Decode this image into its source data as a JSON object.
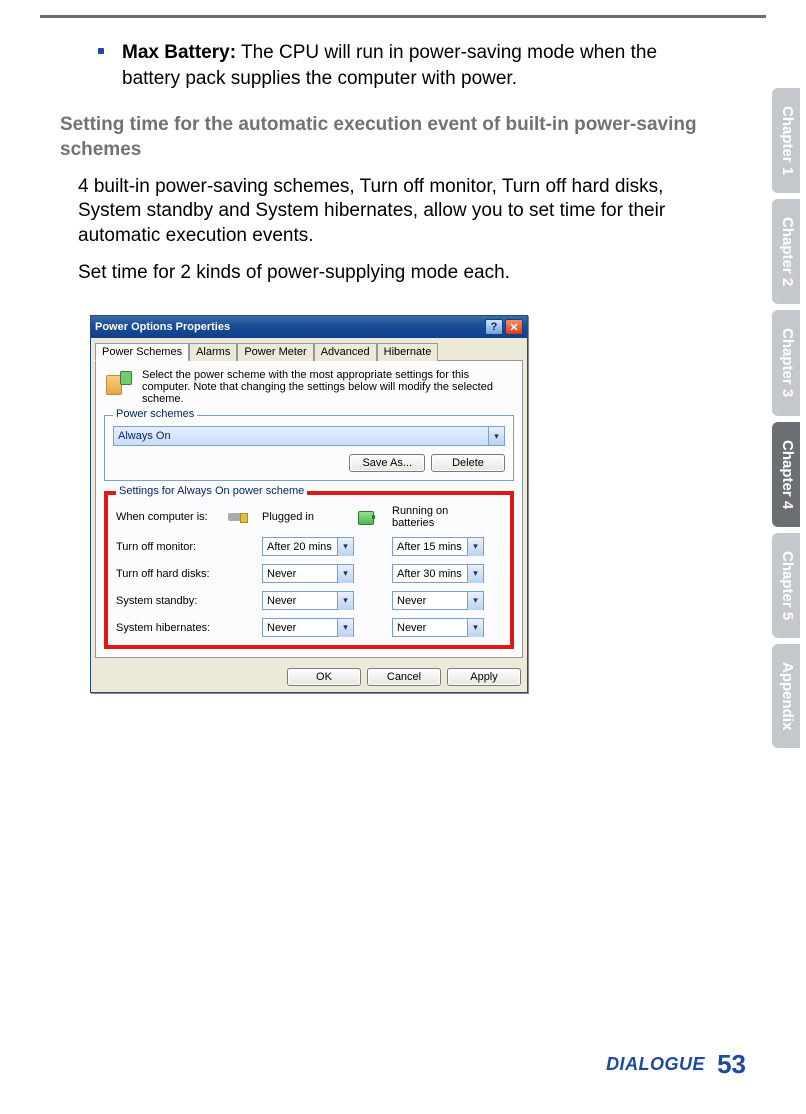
{
  "bullet": {
    "title": "Max Battery:",
    "text": " The CPU will run in power-saving mode when the battery pack supplies the computer with power."
  },
  "heading": "Setting time for the automatic execution event of built-in power-saving schemes",
  "para1": "4 built-in power-saving schemes, Turn off monitor, Turn off hard disks, System standby and System hibernates, allow you to set time for their automatic execution events.",
  "para2": "Set time for 2 kinds of power-supplying mode each.",
  "dialog": {
    "title": "Power Options Properties",
    "help_char": "?",
    "close_char": "✕",
    "tabs": [
      "Power Schemes",
      "Alarms",
      "Power Meter",
      "Advanced",
      "Hibernate"
    ],
    "desc": "Select the power scheme with the most appropriate settings for this computer. Note that changing the settings below will modify the selected scheme.",
    "schemes": {
      "legend": "Power schemes",
      "selected": "Always On",
      "save_as": "Save As...",
      "delete": "Delete"
    },
    "settings": {
      "legend": "Settings for Always On power scheme",
      "header_label": "When computer is:",
      "col1_header": "Plugged in",
      "col2_header": "Running on batteries",
      "rows": [
        {
          "label": "Turn off monitor:",
          "v1": "After 20 mins",
          "v2": "After 15 mins"
        },
        {
          "label": "Turn off hard disks:",
          "v1": "Never",
          "v2": "After 30 mins"
        },
        {
          "label": "System standby:",
          "v1": "Never",
          "v2": "Never"
        },
        {
          "label": "System hibernates:",
          "v1": "Never",
          "v2": "Never"
        }
      ]
    },
    "buttons": {
      "ok": "OK",
      "cancel": "Cancel",
      "apply": "Apply"
    }
  },
  "side_tabs": [
    "Chapter 1",
    "Chapter 2",
    "Chapter 3",
    "Chapter 4",
    "Chapter 5",
    "Appendix"
  ],
  "active_side_tab_index": 3,
  "footer": {
    "brand": "DIALOGUE",
    "page": "53"
  }
}
